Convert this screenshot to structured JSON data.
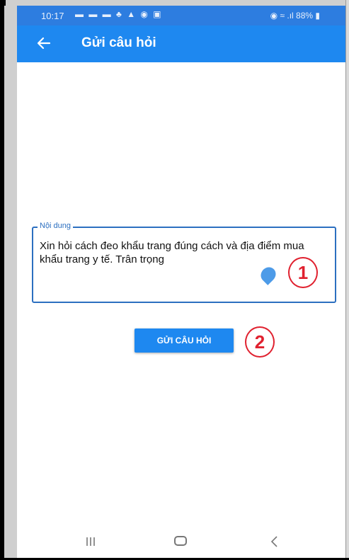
{
  "status_bar": {
    "time": "10:17",
    "icons": "▬ ▬ ▬ ♣ ▲ ◉ ▣",
    "right": "◉ ≈ .ıl 88% ▮"
  },
  "app_bar": {
    "title": "Gửi câu hỏi"
  },
  "form": {
    "label": "Nội dung",
    "value": "Xin hỏi cách đeo khẩu trang đúng cách và địa điểm mua khẩu trang y tế. Trân trọng",
    "submit_label": "GỬI CÂU HỎI"
  },
  "annotations": {
    "one": "1",
    "two": "2"
  },
  "colors": {
    "status_bar": "#2d7de0",
    "app_bar": "#1e88f0",
    "accent": "#2c6fc0",
    "annotation": "#e0212f"
  }
}
